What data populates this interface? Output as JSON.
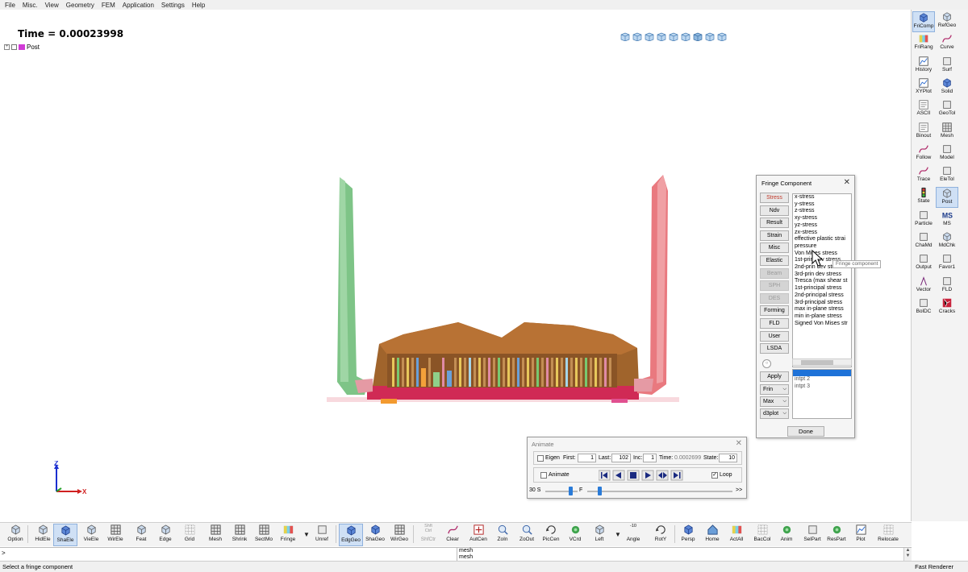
{
  "menu": [
    "File",
    "Misc.",
    "View",
    "Geometry",
    "FEM",
    "Application",
    "Settings",
    "Help"
  ],
  "viewport": {
    "time_label": "Time =  0.00023998",
    "tree_item": "Post",
    "axis_x": "X",
    "axis_z": "Z"
  },
  "right_toolbar": [
    {
      "label": "FriComp",
      "icon": "fringe-component-icon",
      "active": true
    },
    {
      "label": "RefGeo",
      "icon": "reference-geometry-icon"
    },
    {
      "label": "FriRang",
      "icon": "fringe-range-icon"
    },
    {
      "label": "Curve",
      "icon": "curve-icon"
    },
    {
      "label": "History",
      "icon": "history-icon"
    },
    {
      "label": "Surf",
      "icon": "surface-icon"
    },
    {
      "label": "XYPlot",
      "icon": "xyplot-icon"
    },
    {
      "label": "Solid",
      "icon": "solid-icon"
    },
    {
      "label": "ASCII",
      "icon": "ascii-icon"
    },
    {
      "label": "GeoTol",
      "icon": "geometry-tolerance-icon"
    },
    {
      "label": "Binout",
      "icon": "binout-icon"
    },
    {
      "label": "Mesh",
      "icon": "mesh-icon"
    },
    {
      "label": "Follow",
      "icon": "follow-icon"
    },
    {
      "label": "Model",
      "icon": "model-icon"
    },
    {
      "label": "Trace",
      "icon": "trace-icon"
    },
    {
      "label": "EleTol",
      "icon": "element-tolerance-icon"
    },
    {
      "label": "State",
      "icon": "state-icon"
    },
    {
      "label": "Post",
      "icon": "post-icon",
      "active": true
    },
    {
      "label": "Particle",
      "icon": "particle-icon"
    },
    {
      "label": "MS",
      "icon": "ms-icon"
    },
    {
      "label": "ChaMd",
      "icon": "change-model-icon"
    },
    {
      "label": "MdChk",
      "icon": "model-check-icon"
    },
    {
      "label": "Output",
      "icon": "output-icon"
    },
    {
      "label": "Favor1",
      "icon": "favorite-icon"
    },
    {
      "label": "Vector",
      "icon": "vector-icon"
    },
    {
      "label": "FLD",
      "icon": "fld-icon"
    },
    {
      "label": "BolDC",
      "icon": "bolt-icon"
    },
    {
      "label": "Cracks",
      "icon": "cracks-icon"
    }
  ],
  "bottom_toolbar": [
    {
      "label": "Option",
      "icon": "option-icon"
    },
    {
      "label": "HidEle",
      "icon": "hidden-element-icon"
    },
    {
      "label": "ShaEle",
      "icon": "shaded-element-icon",
      "active": true
    },
    {
      "label": "VieEle",
      "icon": "view-element-icon"
    },
    {
      "label": "WirEle",
      "icon": "wire-element-icon"
    },
    {
      "label": "Feat",
      "icon": "feature-icon"
    },
    {
      "label": "Edge",
      "icon": "edge-icon"
    },
    {
      "label": "Grid",
      "icon": "grid-icon"
    },
    {
      "label": "Mesh",
      "icon": "mesh-icon"
    },
    {
      "label": "Shrink",
      "icon": "shrink-icon"
    },
    {
      "label": "SectMo",
      "icon": "section-icon"
    },
    {
      "label": "Fringe",
      "icon": "fringe-icon"
    },
    {
      "label": "Unref",
      "icon": "unreferenced-icon"
    },
    {
      "label": "EdgGeo",
      "icon": "edge-geometry-icon",
      "active": true
    },
    {
      "label": "ShaGeo",
      "icon": "shaded-geometry-icon"
    },
    {
      "label": "WirGeo",
      "icon": "wire-geometry-icon"
    },
    {
      "label": "ShfCtr",
      "icon": "shift-ctrl-icon",
      "top": "Shft\nCtrl",
      "dim": true
    },
    {
      "label": "Clear",
      "icon": "clear-icon"
    },
    {
      "label": "AutCen",
      "icon": "auto-center-icon"
    },
    {
      "label": "ZoIn",
      "icon": "zoom-in-icon"
    },
    {
      "label": "ZoOut",
      "icon": "zoom-out-icon"
    },
    {
      "label": "PicCen",
      "icon": "pick-center-icon"
    },
    {
      "label": "VCrd",
      "icon": "view-coordinate-icon"
    },
    {
      "label": "Left",
      "icon": "left-view-icon"
    },
    {
      "label": "Angle",
      "icon": "angle-icon",
      "top": "-10"
    },
    {
      "label": "RotY",
      "icon": "rotate-y-icon"
    },
    {
      "label": "Persp",
      "icon": "perspective-icon"
    },
    {
      "label": "Home",
      "icon": "home-icon"
    },
    {
      "label": "ActAll",
      "icon": "activate-all-icon"
    },
    {
      "label": "BacCol",
      "icon": "background-color-icon"
    },
    {
      "label": "Anim",
      "icon": "animate-icon"
    },
    {
      "label": "SelPart",
      "icon": "select-part-icon"
    },
    {
      "label": "ResPart",
      "icon": "restore-part-icon"
    },
    {
      "label": "Plot",
      "icon": "plot-icon"
    },
    {
      "label": "Relocate",
      "icon": "relocate-icon"
    }
  ],
  "command": {
    "prompt": ">",
    "history": [
      "mesh",
      "mesh"
    ]
  },
  "status": {
    "message": "Select a fringe component",
    "renderer": "Fast Renderer"
  },
  "fringe_dialog": {
    "title": "Fringe Component",
    "categories": [
      {
        "label": "Stress",
        "state": "selected"
      },
      {
        "label": "Ndv",
        "state": "normal"
      },
      {
        "label": "Result",
        "state": "normal"
      },
      {
        "label": "Strain",
        "state": "normal"
      },
      {
        "label": "Misc",
        "state": "normal"
      },
      {
        "label": "Elastic",
        "state": "normal"
      },
      {
        "label": "Beam",
        "state": "disabled"
      },
      {
        "label": "SPH",
        "state": "disabled"
      },
      {
        "label": "DES",
        "state": "disabled"
      },
      {
        "label": "Forming",
        "state": "normal"
      },
      {
        "label": "FLD",
        "state": "normal"
      },
      {
        "label": "User",
        "state": "normal"
      },
      {
        "label": "LSDA",
        "state": "normal"
      }
    ],
    "components": [
      "x-stress",
      "y-stress",
      "z-stress",
      "xy-stress",
      "yz-stress",
      "zx-stress",
      "effective plastic strai",
      "pressure",
      "Von Mises stress",
      "1st-prin dev stress",
      "2nd-prin dev stress",
      "3rd-prin dev stress",
      "Tresca (max shear st",
      "1st-principal stress",
      "2nd-principal stress",
      "3rd-principal stress",
      "max in-plane stress",
      "min in-plane stress",
      "Signed Von Mises str"
    ],
    "intpt": [
      "intpt  2",
      "intpt  3"
    ],
    "apply_label": "Apply",
    "dropdowns": [
      "Frin",
      "Max",
      "d3plot"
    ],
    "done_label": "Done",
    "tooltip": "Fringe component"
  },
  "animate_dialog": {
    "title": "Animate",
    "eigen_label": "Eigen",
    "first_label": "First:",
    "first_value": "1",
    "last_label": "Last:",
    "last_value": "102",
    "inc_label": "Inc:",
    "inc_value": "1",
    "time_label": "Time:",
    "time_value": "0.0002699",
    "state_label": "State:",
    "state_value": "10",
    "animate_label": "Animate",
    "loop_label": "Loop",
    "loop_checked": true,
    "speed_label": "30 S",
    "frame_label": "F",
    "forward_label": ">>"
  }
}
